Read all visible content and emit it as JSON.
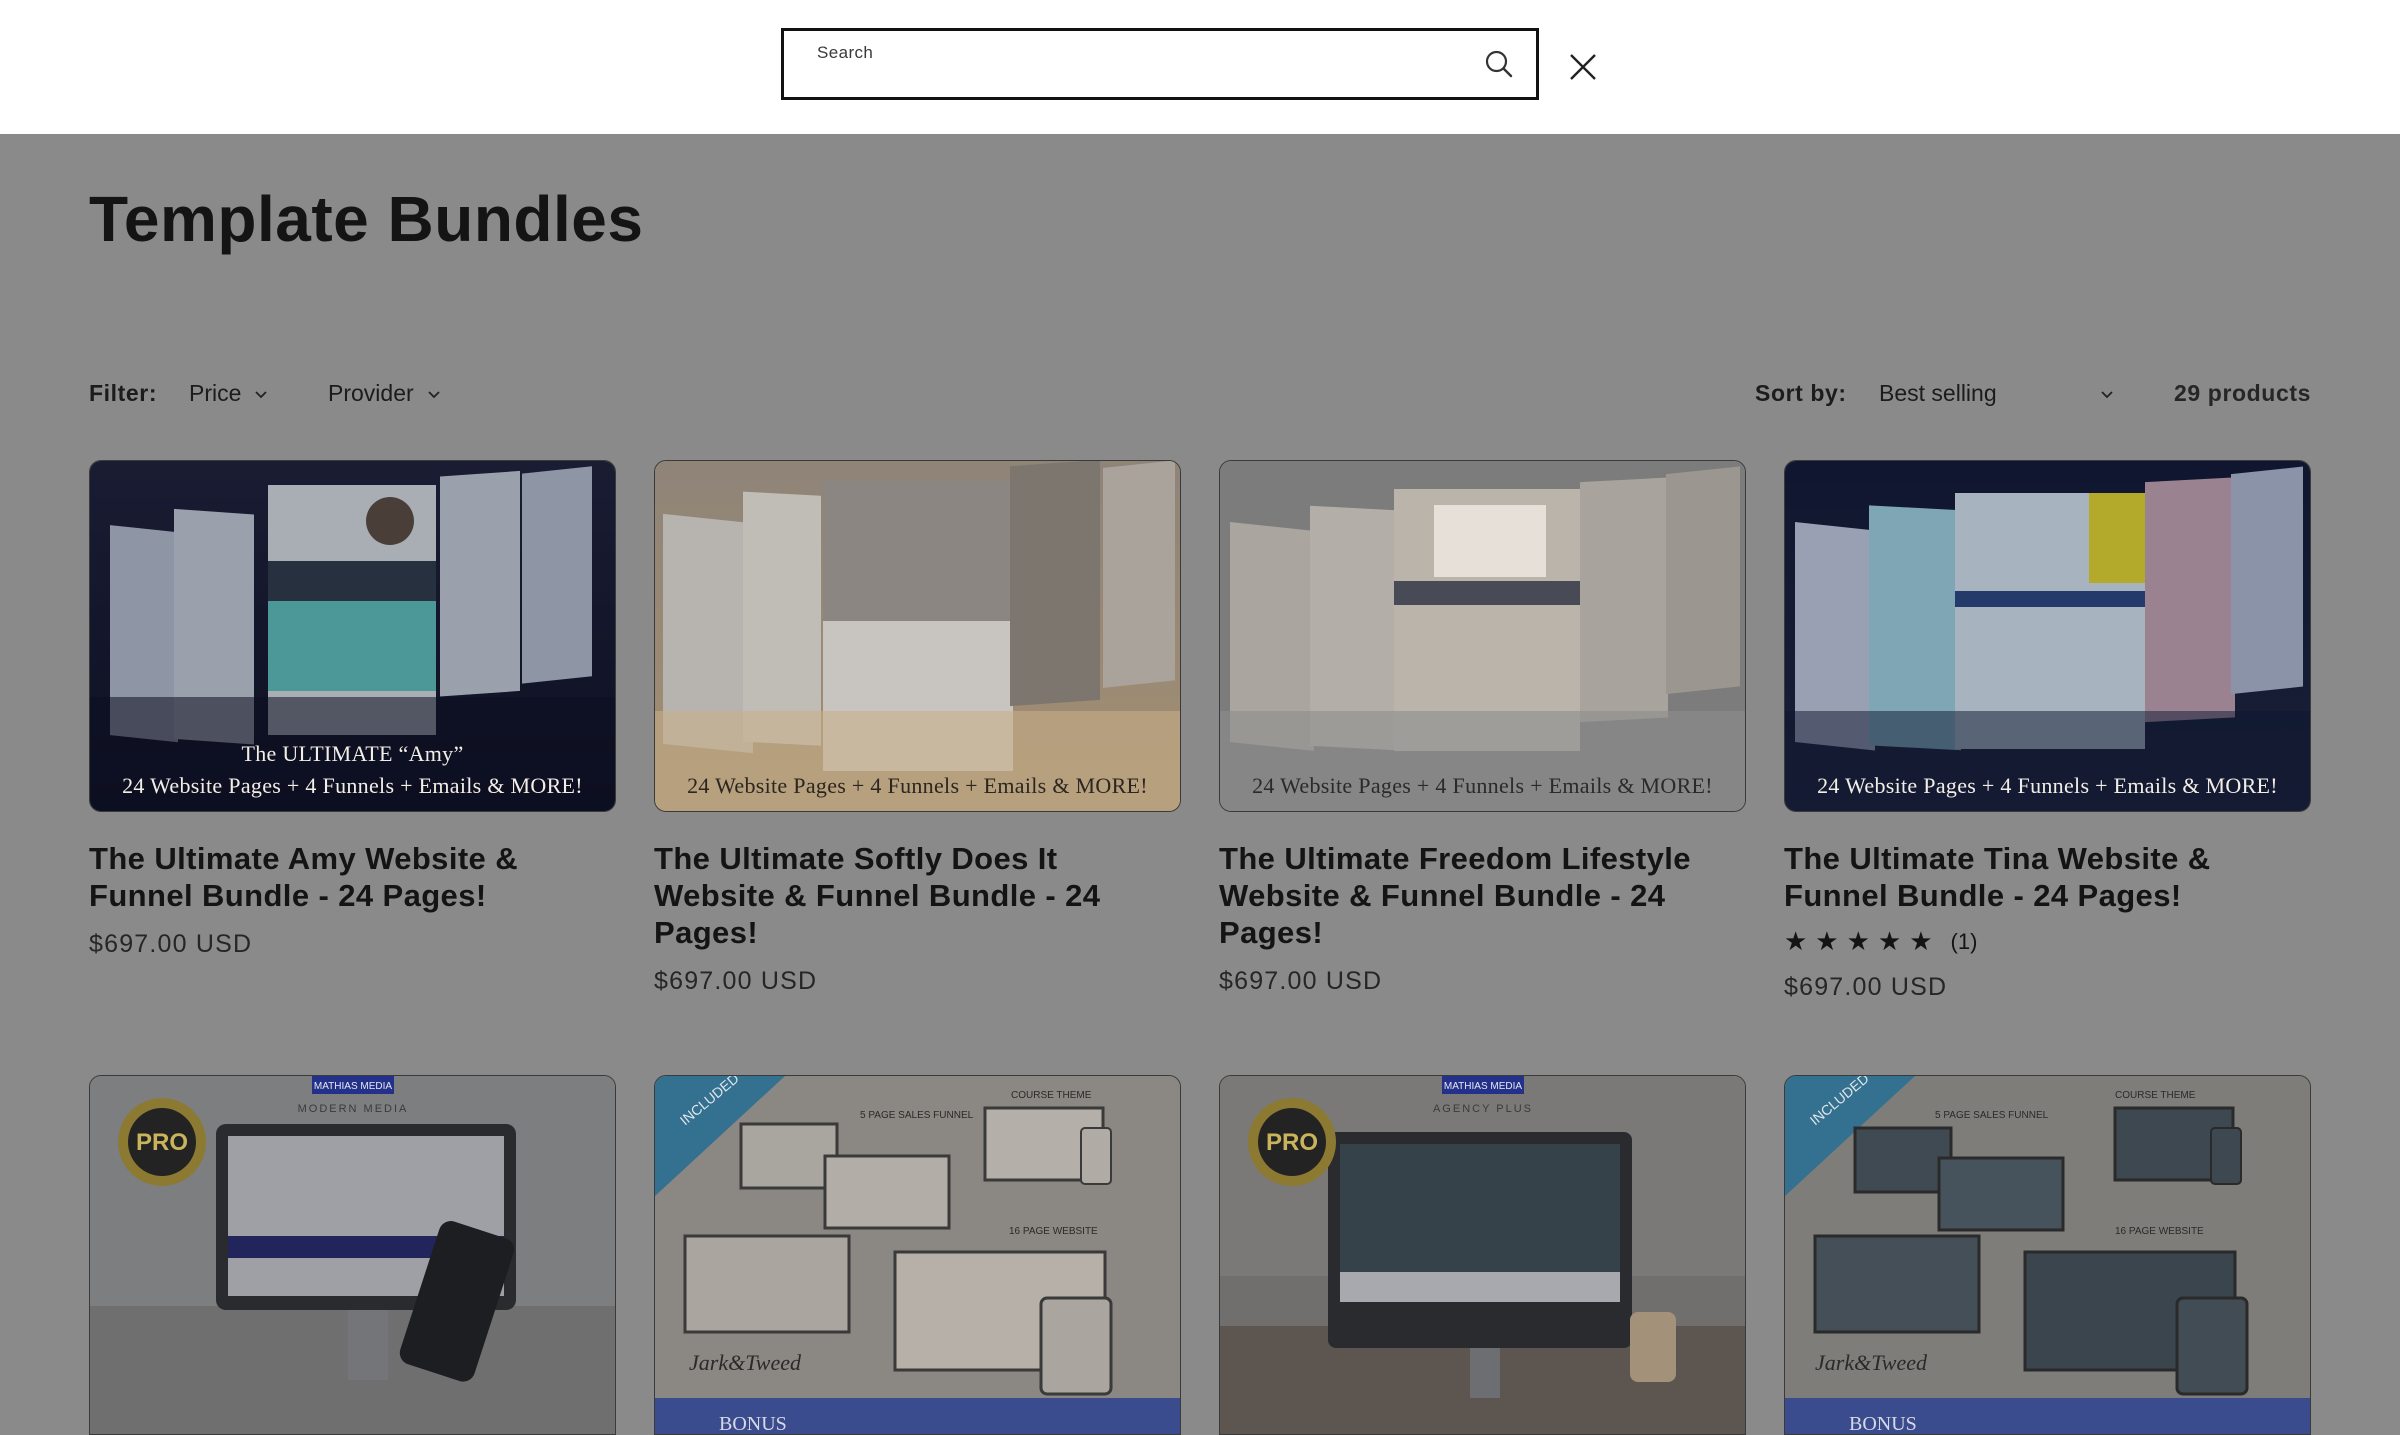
{
  "search": {
    "label": "Search",
    "value": "",
    "placeholder": "Search"
  },
  "page": {
    "title": "Template Bundles"
  },
  "filters": {
    "label": "Filter:",
    "price": "Price",
    "provider": "Provider",
    "sort_label": "Sort by:",
    "sort_value": "Best selling",
    "count": "29 products"
  },
  "products": [
    {
      "title": "The Ultimate Amy Website & Funnel Bundle - 24 Pages!",
      "price": "$697.00 USD",
      "caption_top": "The ULTIMATE “Amy”",
      "caption": "24 Website Pages + 4 Funnels + Emails & MORE!"
    },
    {
      "title": "The Ultimate Softly Does It Website & Funnel Bundle - 24 Pages!",
      "price": "$697.00 USD",
      "caption": "24 Website Pages + 4 Funnels + Emails & MORE!"
    },
    {
      "title": "The Ultimate Freedom Lifestyle Website & Funnel Bundle - 24 Pages!",
      "price": "$697.00 USD",
      "caption": "24 Website Pages + 4 Funnels + Emails & MORE!"
    },
    {
      "title": "The Ultimate Tina Website & Funnel Bundle - 24 Pages!",
      "price": "$697.00 USD",
      "caption": "24 Website Pages + 4 Funnels + Emails & MORE!",
      "rating_stars": "★★★★★",
      "rating_count": "(1)",
      "rating_value": 5
    }
  ],
  "row2": [
    {
      "badge": "PRO",
      "top_label": "MATHIAS MEDIA",
      "sub_label": "MODERN MEDIA"
    },
    {
      "ribbon": "INCLUDED",
      "top_label": "COURSE THEME",
      "sub_label": "5 PAGE SALES FUNNEL",
      "bottom_label": "16 PAGE WEBSITE",
      "brand": "Jark&Tweed",
      "bonus": "BONUS"
    },
    {
      "badge": "PRO",
      "top_label": "MATHIAS MEDIA",
      "sub_label": "AGENCY PLUS"
    },
    {
      "ribbon": "INCLUDED",
      "top_label": "COURSE THEME",
      "sub_label": "5 PAGE SALES FUNNEL",
      "bottom_label": "16 PAGE WEBSITE",
      "brand": "Jark&Tweed",
      "bonus": "BONUS"
    }
  ],
  "colors": {
    "overlay": "#8a8a8a",
    "header_bg": "#ffffff",
    "text": "#141414"
  }
}
